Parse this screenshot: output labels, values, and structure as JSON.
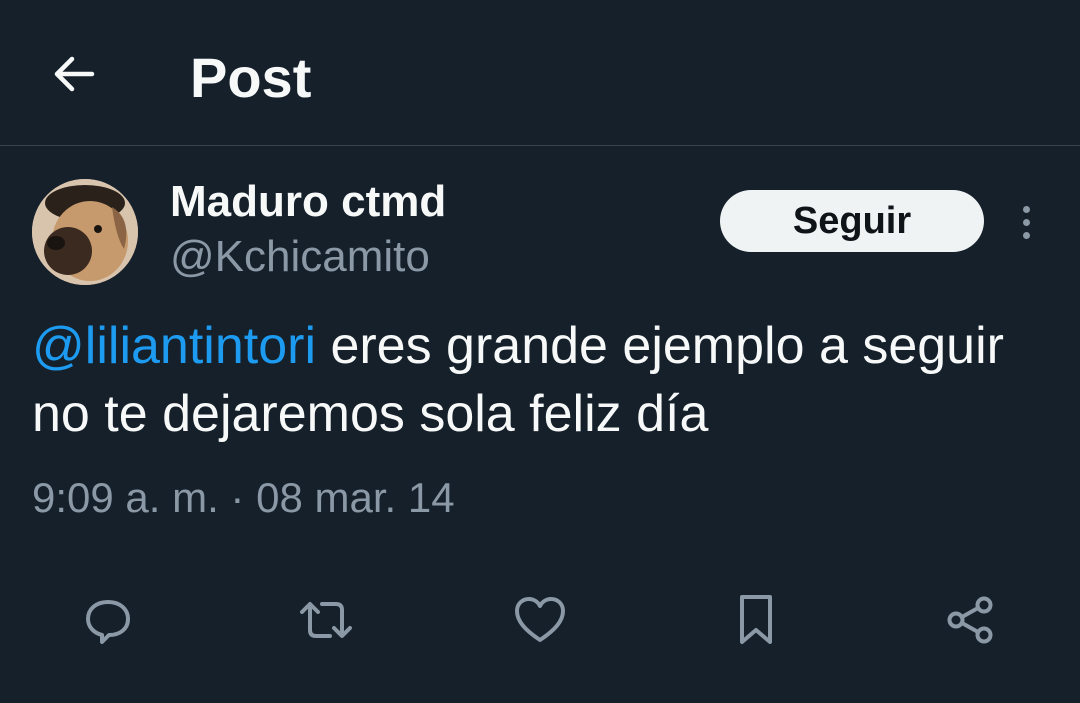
{
  "header": {
    "title": "Post",
    "back_icon": "arrow-left-icon"
  },
  "author": {
    "display_name": "Maduro ctmd",
    "handle": "@Kchicamito",
    "avatar_icon": "dog-avatar"
  },
  "follow": {
    "label": "Seguir"
  },
  "tweet": {
    "mention": "@liliantintori",
    "text": " eres grande ejemplo a seguir no te dejaremos sola feliz día"
  },
  "meta": {
    "time": "9:09 a. m.",
    "separator": " · ",
    "date": "08 mar. 14"
  },
  "actions": [
    "reply-icon",
    "retweet-icon",
    "like-icon",
    "bookmark-icon",
    "share-icon"
  ],
  "colors": {
    "background": "#15202b",
    "text": "#f7f9f9",
    "secondary": "#8b98a5",
    "accent": "#1d9bf0",
    "divider": "#38444d"
  }
}
